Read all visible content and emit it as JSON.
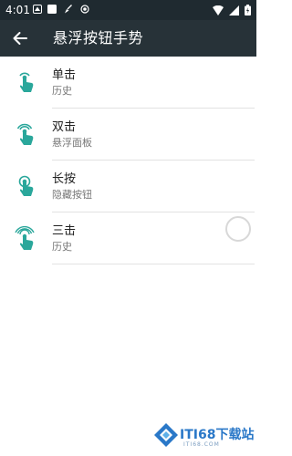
{
  "status_bar": {
    "time": "4:01"
  },
  "app_bar": {
    "title": "悬浮按钮手势"
  },
  "gestures": [
    {
      "title": "单击",
      "action": "历史",
      "icon": "single-tap-icon"
    },
    {
      "title": "双击",
      "action": "悬浮面板",
      "icon": "double-tap-icon"
    },
    {
      "title": "长按",
      "action": "隐藏按钮",
      "icon": "long-press-icon"
    },
    {
      "title": "三击",
      "action": "历史",
      "icon": "triple-tap-icon"
    }
  ],
  "colors": {
    "accent": "#2aa79b",
    "appbar": "#273238",
    "statusbar": "#1f2a30"
  },
  "watermark": {
    "text": "ITI68下载站",
    "sub": "ITI68.COM"
  }
}
